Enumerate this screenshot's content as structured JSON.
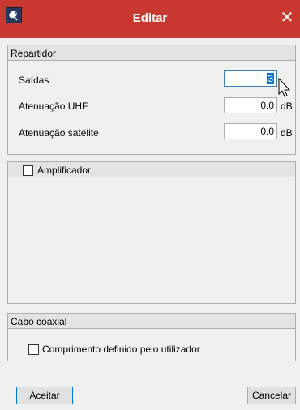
{
  "window": {
    "title": "Editar",
    "close_symbol": "✕",
    "app_icon": "satellite-dish-icon",
    "titlebar_color": "#c8382e"
  },
  "repartidor": {
    "title": "Repartidor",
    "fields": [
      {
        "label": "Saídas",
        "value": "3",
        "unit": ""
      },
      {
        "label": "Atenuação UHF",
        "value": "0.0",
        "unit": "dB"
      },
      {
        "label": "Atenuação satélite",
        "value": "0.0",
        "unit": "dB"
      }
    ]
  },
  "amplificador": {
    "label": "Amplificador",
    "checked": false
  },
  "cabo": {
    "title": "Cabo coaxial",
    "checkbox_label": "Comprimento definido pelo utilizador",
    "checked": false
  },
  "buttons": {
    "accept": "Aceitar",
    "cancel": "Cancelar"
  },
  "colors": {
    "selection": "#0078d7",
    "accent": "#c8382e"
  }
}
